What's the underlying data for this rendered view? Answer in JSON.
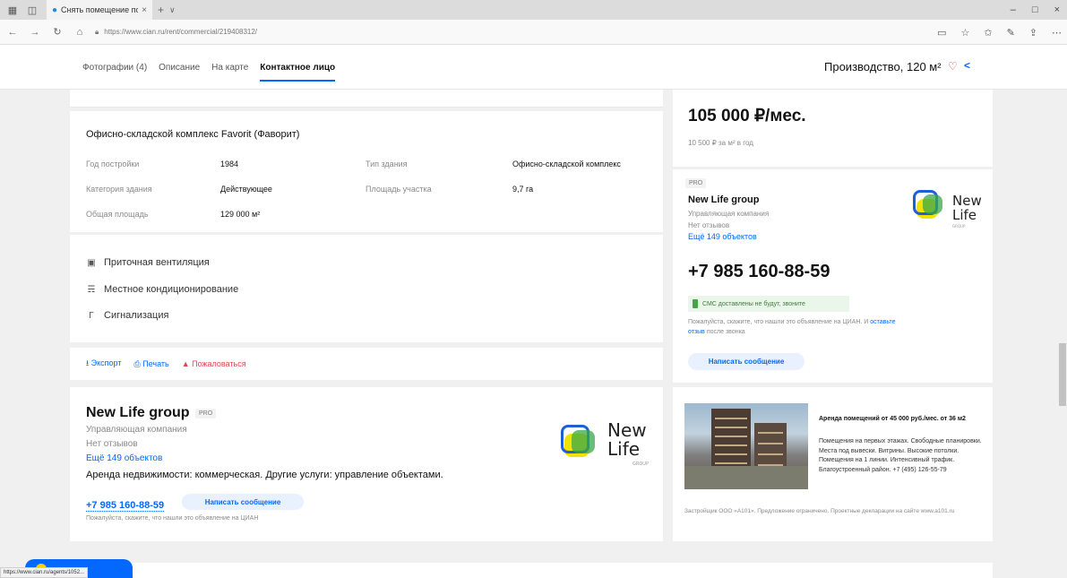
{
  "browser": {
    "tab_title": "Снять помещение под",
    "tab_close": "×",
    "new_tab": "+",
    "tab_menu": "∨",
    "url": "https://www.cian.ru/rent/commercial/219408312/",
    "min": "–",
    "max": "□",
    "close": "×",
    "status_url": "https://www.cian.ru/agents/1052..."
  },
  "header": {
    "tabs": [
      "Фотографии (4)",
      "Описание",
      "На карте",
      "Контактное лицо"
    ],
    "title": "Производство, 120 м²"
  },
  "building": {
    "title": "Офисно-складской комплекс Favorit (Фаворит)",
    "props": [
      {
        "label": "Год постройки",
        "value": "1984"
      },
      {
        "label": "Категория здания",
        "value": "Действующее"
      },
      {
        "label": "Общая площадь",
        "value": "129 000 м²"
      },
      {
        "label": "Тип здания",
        "value": "Офисно-складской комплекс"
      },
      {
        "label": "Площадь участка",
        "value": "9,7 га"
      }
    ]
  },
  "features": [
    {
      "icon": "ventilation-icon",
      "label": "Приточная вентиляция"
    },
    {
      "icon": "conditioner-icon",
      "label": "Местное кондиционирование"
    },
    {
      "icon": "alarm-icon",
      "label": "Сигнализация"
    }
  ],
  "actions": {
    "export": "Экспорт",
    "print": "Печать",
    "complain": "Пожаловаться"
  },
  "agent": {
    "name": "New Life group",
    "pro": "PRO",
    "type": "Управляющая компания",
    "reviews": "Нет отзывов",
    "objects": "Ещё 149 объектов",
    "services": "Аренда недвижимости: коммерческая. Другие услуги: управление объектами.",
    "phone": "+7 985 160-88-59",
    "message_button": "Написать сообщение",
    "note": "Пожалуйста, скажите, что нашли это объявление на ЦИАН"
  },
  "logo": {
    "line1": "New",
    "line2": "Life",
    "sub": "GROUP",
    "colors": {
      "blue": "#1c5fd8",
      "yellow": "#f2e200",
      "green": "#3aa84a"
    }
  },
  "price": {
    "value": "105 000 ₽/мес.",
    "per_year": "10 500 ₽ за м² в год"
  },
  "contact": {
    "pro": "PRO",
    "name": "New Life group",
    "type": "Управляющая компания",
    "reviews": "Нет отзывов",
    "objects": "Ещё 149 объектов",
    "phone": "+7 985 160-88-59",
    "sms": "СМС доставлены не будут, звоните",
    "note_prefix": "Пожалуйста, скажите, что нашли это объявление на ЦИАН. И",
    "note_link": "оставьте отзыв",
    "note_suffix": "после звонка",
    "message_button": "Написать сообщение"
  },
  "ad": {
    "title": "Аренда помещений от 45 000 руб./мес. от 36 м2",
    "text": "Помещения на первых этажах. Свободные планировки. Места под вывески. Витрины. Высокие потолки. Помещения на 1 линии. Интенсивный трафик. Благоустроенный район. +7 (495) 126-55-79",
    "note": "Застройщик ООО «А101». Предложение ограничено. Проектные декларации на сайте www.a101.ru"
  },
  "colors": {
    "accent": "#0468ff",
    "danger": "#e0474c",
    "success": "#47a547"
  }
}
